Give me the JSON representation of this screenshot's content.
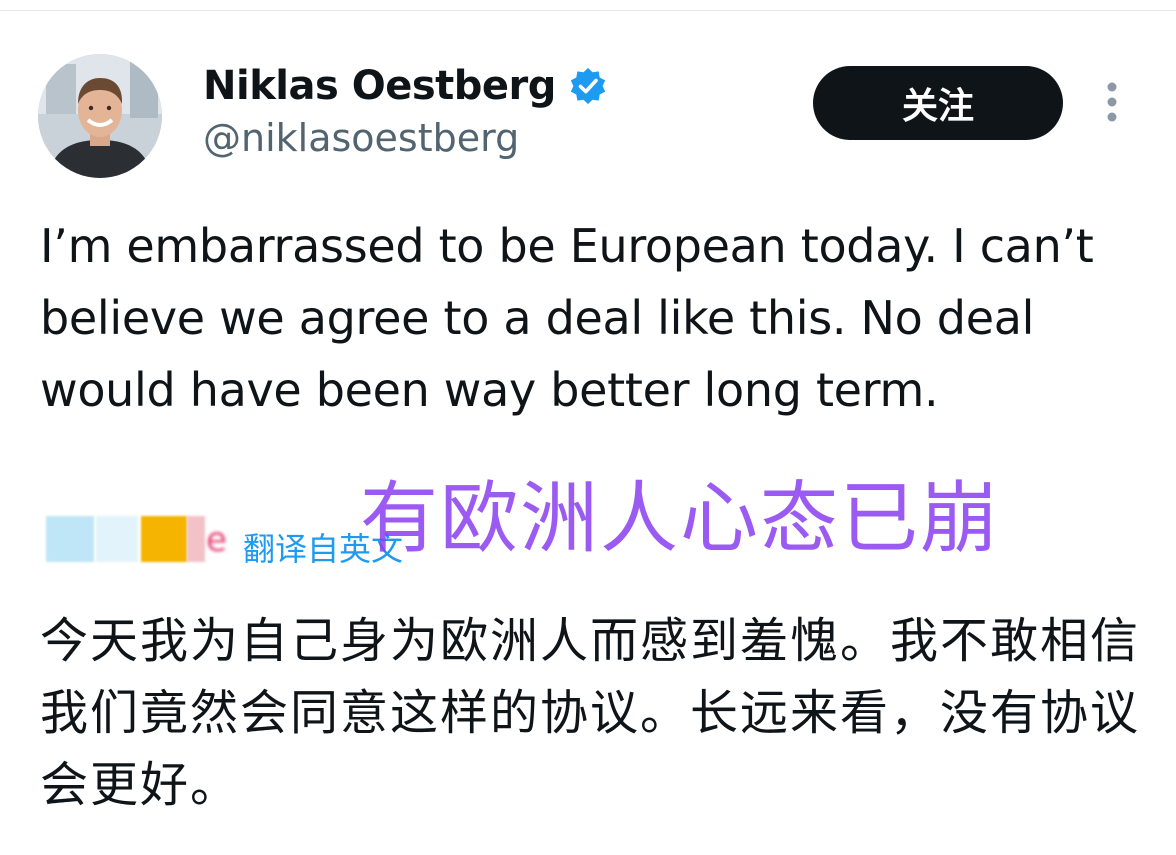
{
  "profile": {
    "display_name": "Niklas Oestberg",
    "handle": "@niklasoestberg",
    "verified": true,
    "avatar_icon": "profile-photo"
  },
  "actions": {
    "follow_label": "关注",
    "more_icon": "vertical-ellipsis-icon"
  },
  "tweet": {
    "text": "I’m embarrassed to be European today. I can’t believe we agree to a deal like this. No deal would have been way better long term."
  },
  "overlay": {
    "caption": "有欧洲人心态已崩"
  },
  "translation": {
    "label": "翻译自英文",
    "text": "今天我为自己身为欧洲人而感到羞愧。我不敢相信我们竟然会同意这样的协议。长远来看，没有协议会更好。"
  },
  "colors": {
    "verified_badge": "#1d9bf0",
    "follow_button_bg": "#0f1419",
    "handle_text": "#536471",
    "translate_link": "#1d9bf0",
    "overlay_caption": "#8a3ff0"
  }
}
